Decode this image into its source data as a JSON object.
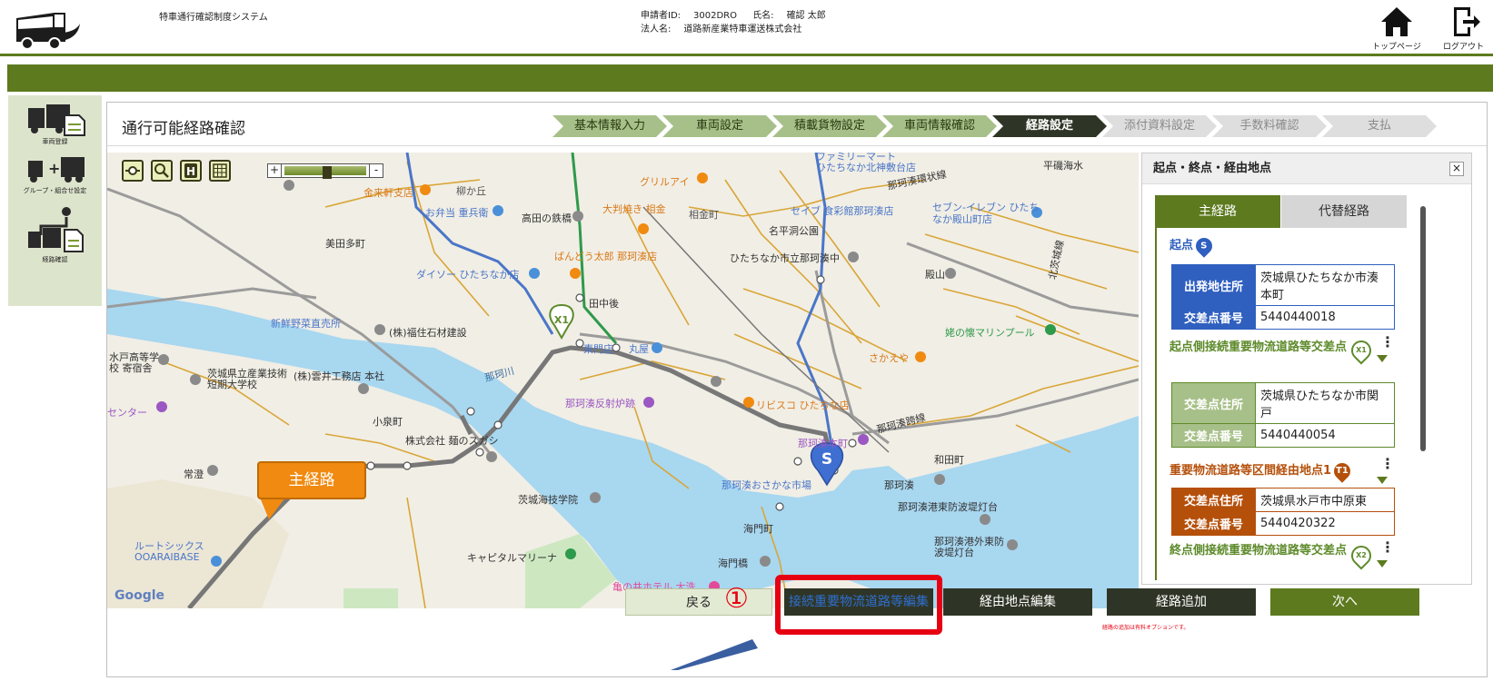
{
  "header": {
    "app_name": "特車通行確認制度システム",
    "applicant_id_label": "申請者ID:",
    "applicant_id": "3002DRO",
    "name_label": "氏名:",
    "name": "確認 太郎",
    "corp_label": "法人名:",
    "corp_name": "道路新産業特車運送株式会社",
    "top_page": "トップページ",
    "logout": "ログアウト"
  },
  "sidebar": {
    "items": [
      {
        "label": "車両登録",
        "icon": "truck-document-icon"
      },
      {
        "label": "グループ・組合せ設定",
        "icon": "truck-combination-icon"
      },
      {
        "label": "経路確認",
        "icon": "route-check-icon"
      }
    ]
  },
  "page": {
    "title": "通行可能経路確認",
    "steps": [
      {
        "label": "基本情報入力",
        "state": "done"
      },
      {
        "label": "車両設定",
        "state": "done"
      },
      {
        "label": "積載貨物設定",
        "state": "done"
      },
      {
        "label": "車両情報確認",
        "state": "done"
      },
      {
        "label": "経路設定",
        "state": "active"
      },
      {
        "label": "添付資料設定",
        "state": "todo"
      },
      {
        "label": "手数料確認",
        "state": "todo"
      },
      {
        "label": "支払",
        "state": "todo"
      }
    ]
  },
  "map": {
    "zoom_plus": "+",
    "zoom_minus": "-",
    "google": "Google",
    "main_route_bubble": "主経路",
    "marker_x1": "X1",
    "marker_s": "S",
    "labels": {
      "l1": "ファミリーマート",
      "l2": "ひたちなか北神敷台店",
      "l3": "平磯海水",
      "l4": "グリルアイ",
      "l5": "那珂湊環状線",
      "l6": "金来軒支店",
      "l7": "柳か丘",
      "l8": "お弁当 重兵衛",
      "l9": "高田の鉄橋",
      "l10": "大判焼き 相金",
      "l11": "相金町",
      "l12": "セイブ 食彩館那珂湊店",
      "l13": "セブン-イレブン ひたちなか殿山町店",
      "l14": "美田多町",
      "l15": "名平洞公園",
      "l16": "ばんどう太郎 那珂湊店",
      "l17": "ひたちなか市立那珂湊中",
      "l18": "殿山",
      "l19": "ダイソー ひたちなか店",
      "l20": "田中後",
      "l21": "新鮮野菜直売所",
      "l22": "(株)福住石材建設",
      "l23": "姥の懐マリンプール",
      "l24": "水戸高等学校 寄宿舎",
      "l25": "茨城県立産業技術短期大学校",
      "l26": "(株)雲井工務店 本社",
      "l27": "那珂川",
      "l28": "東門店",
      "l29": "丸屋",
      "l30": "さかえや",
      "l31": "センター",
      "l32": "那珂湊反射炉跡",
      "l33": "リビスコ ひたちな店",
      "l34": "那珂湊本町",
      "l35": "小泉町",
      "l36": "株式会社 麺のスガシ",
      "l37": "和田町",
      "l38": "常澄",
      "l39": "那珂湊おさかな市場",
      "l40": "那珂湊",
      "l41": "茨城海技学院",
      "l42": "那珂湊港東防波堤灯台",
      "l43": "海門町",
      "l44": "ルートシックス OOARAIBASE",
      "l45": "キャピタルマリーナ",
      "l46": "那珂湊港外東防波堤灯台",
      "l47": "海門橋",
      "l48": "亀の井ホテル 大洗",
      "l49": "那珂湊跨線",
      "l50": "北茨城線"
    }
  },
  "right_panel": {
    "title": "起点・終点・経由地点",
    "close": "×",
    "tab_main": "主経路",
    "tab_alt": "代替経路",
    "start_label": "起点",
    "start_badge": "S",
    "start_addr_key": "出発地住所",
    "start_addr_val": "茨城県ひたちなか市湊本町",
    "start_no_key": "交差点番号",
    "start_no_val": "5440440018",
    "conn1_label": "起点側接続重要物流道路等交差点",
    "conn1_badge": "X1",
    "conn1_addr_key": "交差点住所",
    "conn1_addr_val": "茨城県ひたちなか市関戸",
    "conn1_no_key": "交差点番号",
    "conn1_no_val": "5440440054",
    "via_label": "重要物流道路等区間経由地点1",
    "via_badge": "T1",
    "via_addr_key": "交差点住所",
    "via_addr_val": "茨城県水戸市中原東",
    "via_no_key": "交差点番号",
    "via_no_val": "5440420322",
    "conn2_label": "終点側接続重要物流道路等交差点",
    "conn2_badge": "X2"
  },
  "buttons": {
    "back": "戻る",
    "edit_connection": "接続重要物流道路等編集",
    "edit_waypoint": "経由地点編集",
    "add_route": "経路追加",
    "next": "次へ",
    "note": "経路の追加は有料オプションです。",
    "callout_number": "①"
  },
  "colors": {
    "brand_green": "#5d7a1f",
    "dark": "#2f3526",
    "orange": "#f08a10",
    "brown": "#b5500b",
    "callout_red": "#e60012"
  }
}
